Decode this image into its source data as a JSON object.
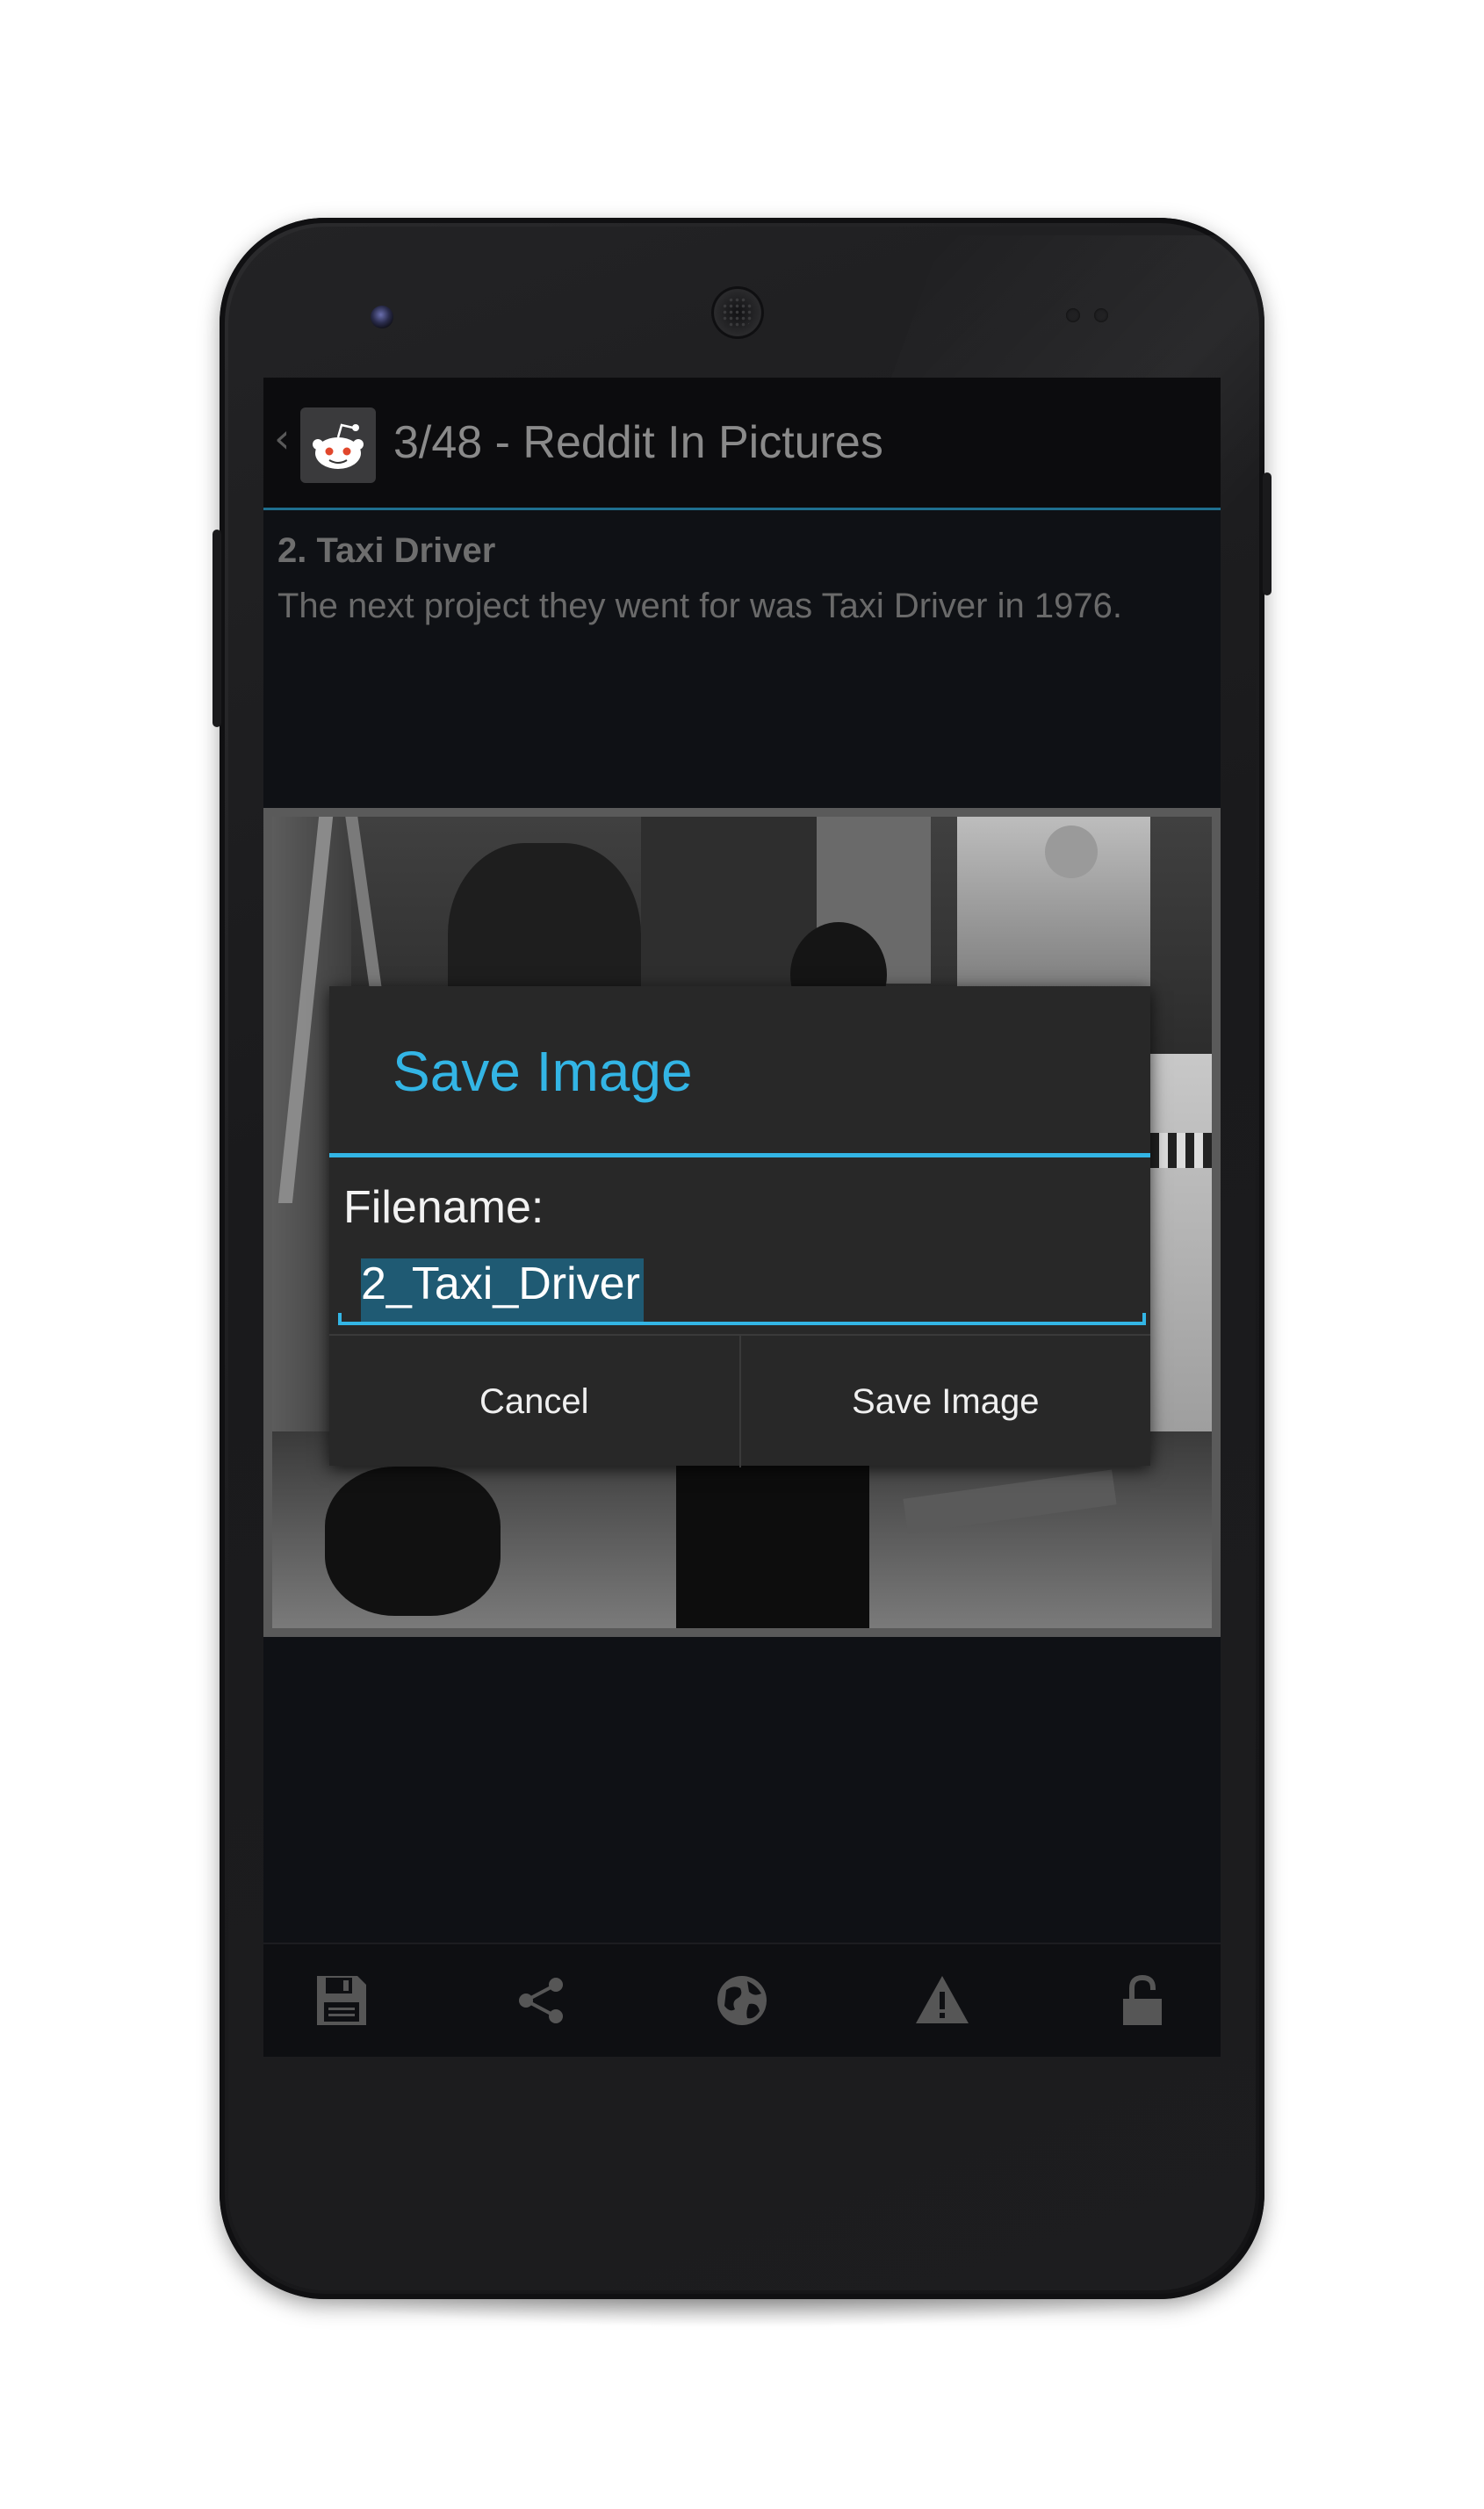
{
  "action_bar": {
    "title": "3/48 - Reddit In Pictures",
    "back_icon": "chevron-left-icon",
    "app_icon": "reddit-alien-icon"
  },
  "post": {
    "title": "2. Taxi Driver",
    "body": "The next project they went for was Taxi Driver in 1976."
  },
  "dialog": {
    "title": "Save Image",
    "field_label": "Filename:",
    "filename_value": "2_Taxi_Driver",
    "cancel_label": "Cancel",
    "confirm_label": "Save Image"
  },
  "bottom_bar": {
    "icons": [
      "save-icon",
      "share-icon",
      "globe-icon",
      "warning-icon",
      "lock-icon"
    ]
  },
  "colors": {
    "accent": "#33b5e5",
    "dialog_bg": "#282828",
    "screen_bg": "#0f1115",
    "selection": "#1f5a73"
  }
}
